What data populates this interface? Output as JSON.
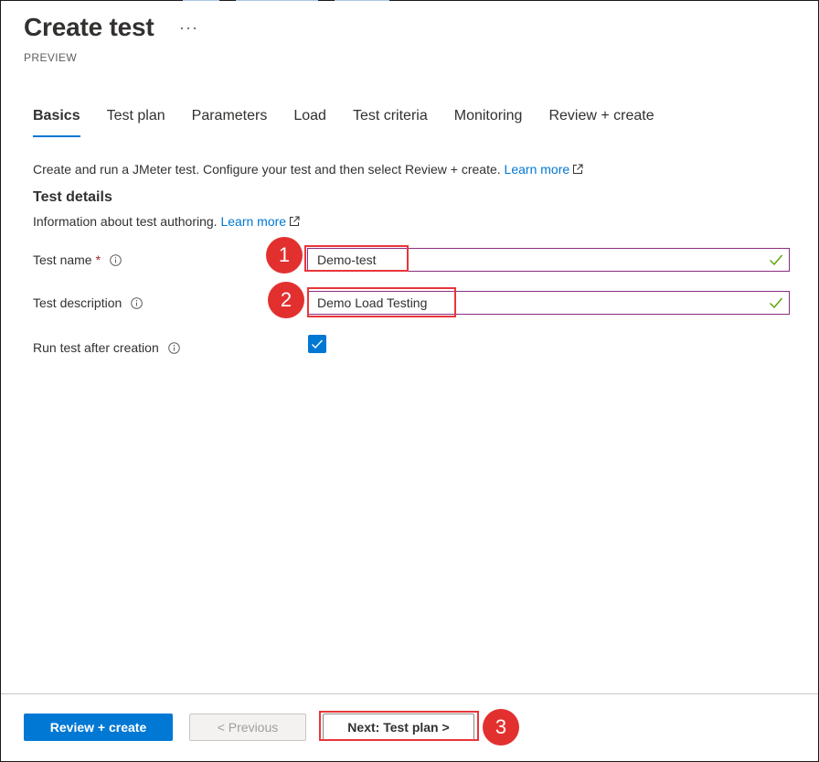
{
  "header": {
    "title": "Create test",
    "more_label": "···",
    "subtitle": "PREVIEW"
  },
  "tabs": [
    {
      "label": "Basics",
      "active": true
    },
    {
      "label": "Test plan",
      "active": false
    },
    {
      "label": "Parameters",
      "active": false
    },
    {
      "label": "Load",
      "active": false
    },
    {
      "label": "Test criteria",
      "active": false
    },
    {
      "label": "Monitoring",
      "active": false
    },
    {
      "label": "Review + create",
      "active": false
    }
  ],
  "intro": {
    "text": "Create and run a JMeter test. Configure your test and then select Review + create. ",
    "link": "Learn more"
  },
  "details": {
    "heading": "Test details",
    "description": "Information about test authoring. ",
    "link": "Learn more"
  },
  "form": {
    "test_name": {
      "label": "Test name",
      "required_mark": "*",
      "value": "Demo-test"
    },
    "test_description": {
      "label": "Test description",
      "value": "Demo Load Testing"
    },
    "run_after_creation": {
      "label": "Run test after creation",
      "checked": true
    }
  },
  "annotations": {
    "badge_1": "1",
    "badge_2": "2",
    "badge_3": "3",
    "color": "#e2302f"
  },
  "footer": {
    "review_create": "Review + create",
    "previous": "< Previous",
    "next": "Next: Test plan >"
  },
  "colors": {
    "accent": "#0078d4",
    "input_border": "#8a2d82",
    "success": "#57a300",
    "highlight": "#e8363b"
  }
}
